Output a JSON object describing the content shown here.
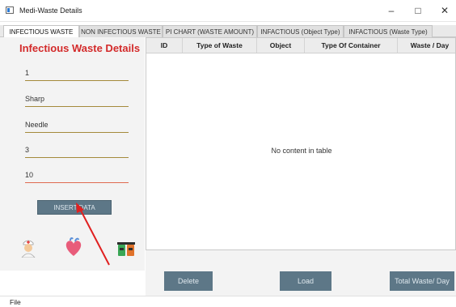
{
  "window": {
    "title": "Medi-Waste Details",
    "minimize_glyph": "–",
    "maximize_glyph": "□",
    "close_glyph": "✕"
  },
  "tabs": [
    {
      "label": "INFECTIOUS WASTE",
      "active": true
    },
    {
      "label": "NON INFECTIOUS WASTE",
      "active": false
    },
    {
      "label": "PI CHART (WASTE AMOUNT)",
      "active": false
    },
    {
      "label": "INFACTIOUS (Object Type)",
      "active": false
    },
    {
      "label": "INFACTIOUS (Waste Type)",
      "active": false
    }
  ],
  "form": {
    "title": "Infectious Waste Details",
    "fields": [
      "1",
      "Sharp",
      "Needle",
      "3",
      "10"
    ],
    "insert_label": "INSERT DATA"
  },
  "icons": [
    "nurse-icon",
    "heart-icon",
    "waste-bins-icon"
  ],
  "table": {
    "columns": [
      "ID",
      "Type of Waste",
      "Object",
      "Type Of Container",
      "Waste / Day"
    ],
    "empty_message": "No content in table"
  },
  "actions": {
    "delete_label": "Delete",
    "load_label": "Load",
    "total_label": "Total Waste/ Day"
  },
  "menu": {
    "file_label": "File"
  },
  "colors": {
    "button": "#5d7787",
    "title_red": "#d32a2a",
    "annotation_arrow": "#e02020"
  }
}
